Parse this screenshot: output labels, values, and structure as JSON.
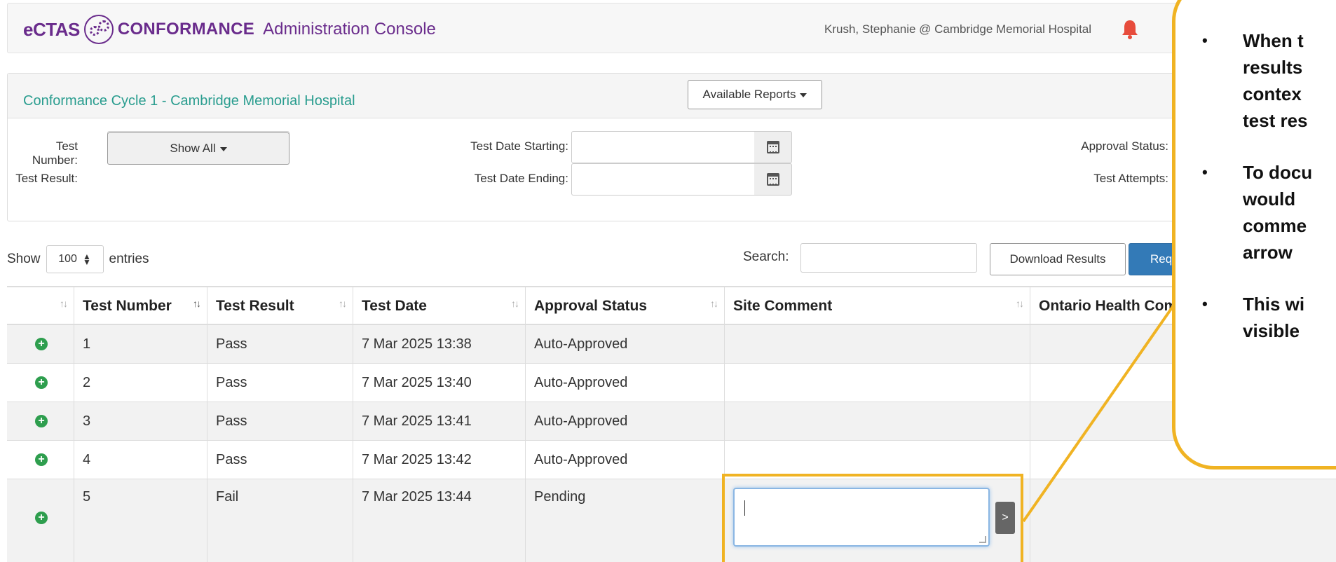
{
  "header": {
    "brand_ectas": "eCTAS",
    "brand_conformance": "CONFORMANCE",
    "brand_admin": "Administration Console",
    "user": "Krush, Stephanie @ Cambridge Memorial Hospital",
    "help_label": "?",
    "icons": [
      "bell-icon",
      "help-icon"
    ]
  },
  "panel": {
    "title": "Conformance Cycle 1 - Cambridge Memorial Hospital",
    "reports_label": "Available Reports",
    "filters": {
      "test_number_label": "Test Number:",
      "test_number_value": "",
      "test_result_label": "Test Result:",
      "test_result_value": "Show All",
      "date_start_label": "Test Date Starting:",
      "date_end_label": "Test Date Ending:",
      "approval_status_label": "Approval Status:",
      "test_attempts_label": "Test Attempts:"
    }
  },
  "list_controls": {
    "show_label": "Show",
    "entries_value": "100",
    "entries_label": "entries",
    "search_label": "Search:",
    "search_value": "",
    "download_label": "Download Results",
    "request_label": "Request"
  },
  "table": {
    "headers": [
      "Test Number",
      "Test Result",
      "Test Date",
      "Approval Status",
      "Site Comment",
      "Ontario Health Comm"
    ],
    "rows": [
      {
        "num": "1",
        "result": "Pass",
        "date": "7 Mar 2025 13:38",
        "status": "Auto-Approved"
      },
      {
        "num": "2",
        "result": "Pass",
        "date": "7 Mar 2025 13:40",
        "status": "Auto-Approved"
      },
      {
        "num": "3",
        "result": "Pass",
        "date": "7 Mar 2025 13:41",
        "status": "Auto-Approved"
      },
      {
        "num": "4",
        "result": "Pass",
        "date": "7 Mar 2025 13:42",
        "status": "Auto-Approved"
      },
      {
        "num": "5",
        "result": "Fail",
        "date": "7 Mar 2025 13:44",
        "status": "Pending"
      }
    ],
    "send_label": ">"
  },
  "callout": {
    "items": [
      "When t\nresults\ncontex\ntest res",
      "To docu\nwould\ncomme\narrow",
      "This wi\nvisible"
    ]
  },
  "colors": {
    "brand": "#6a2c8c",
    "accent": "#2a9d8f",
    "primary": "#337ab7",
    "highlight": "#f0b323",
    "success": "#2e9e4e"
  }
}
